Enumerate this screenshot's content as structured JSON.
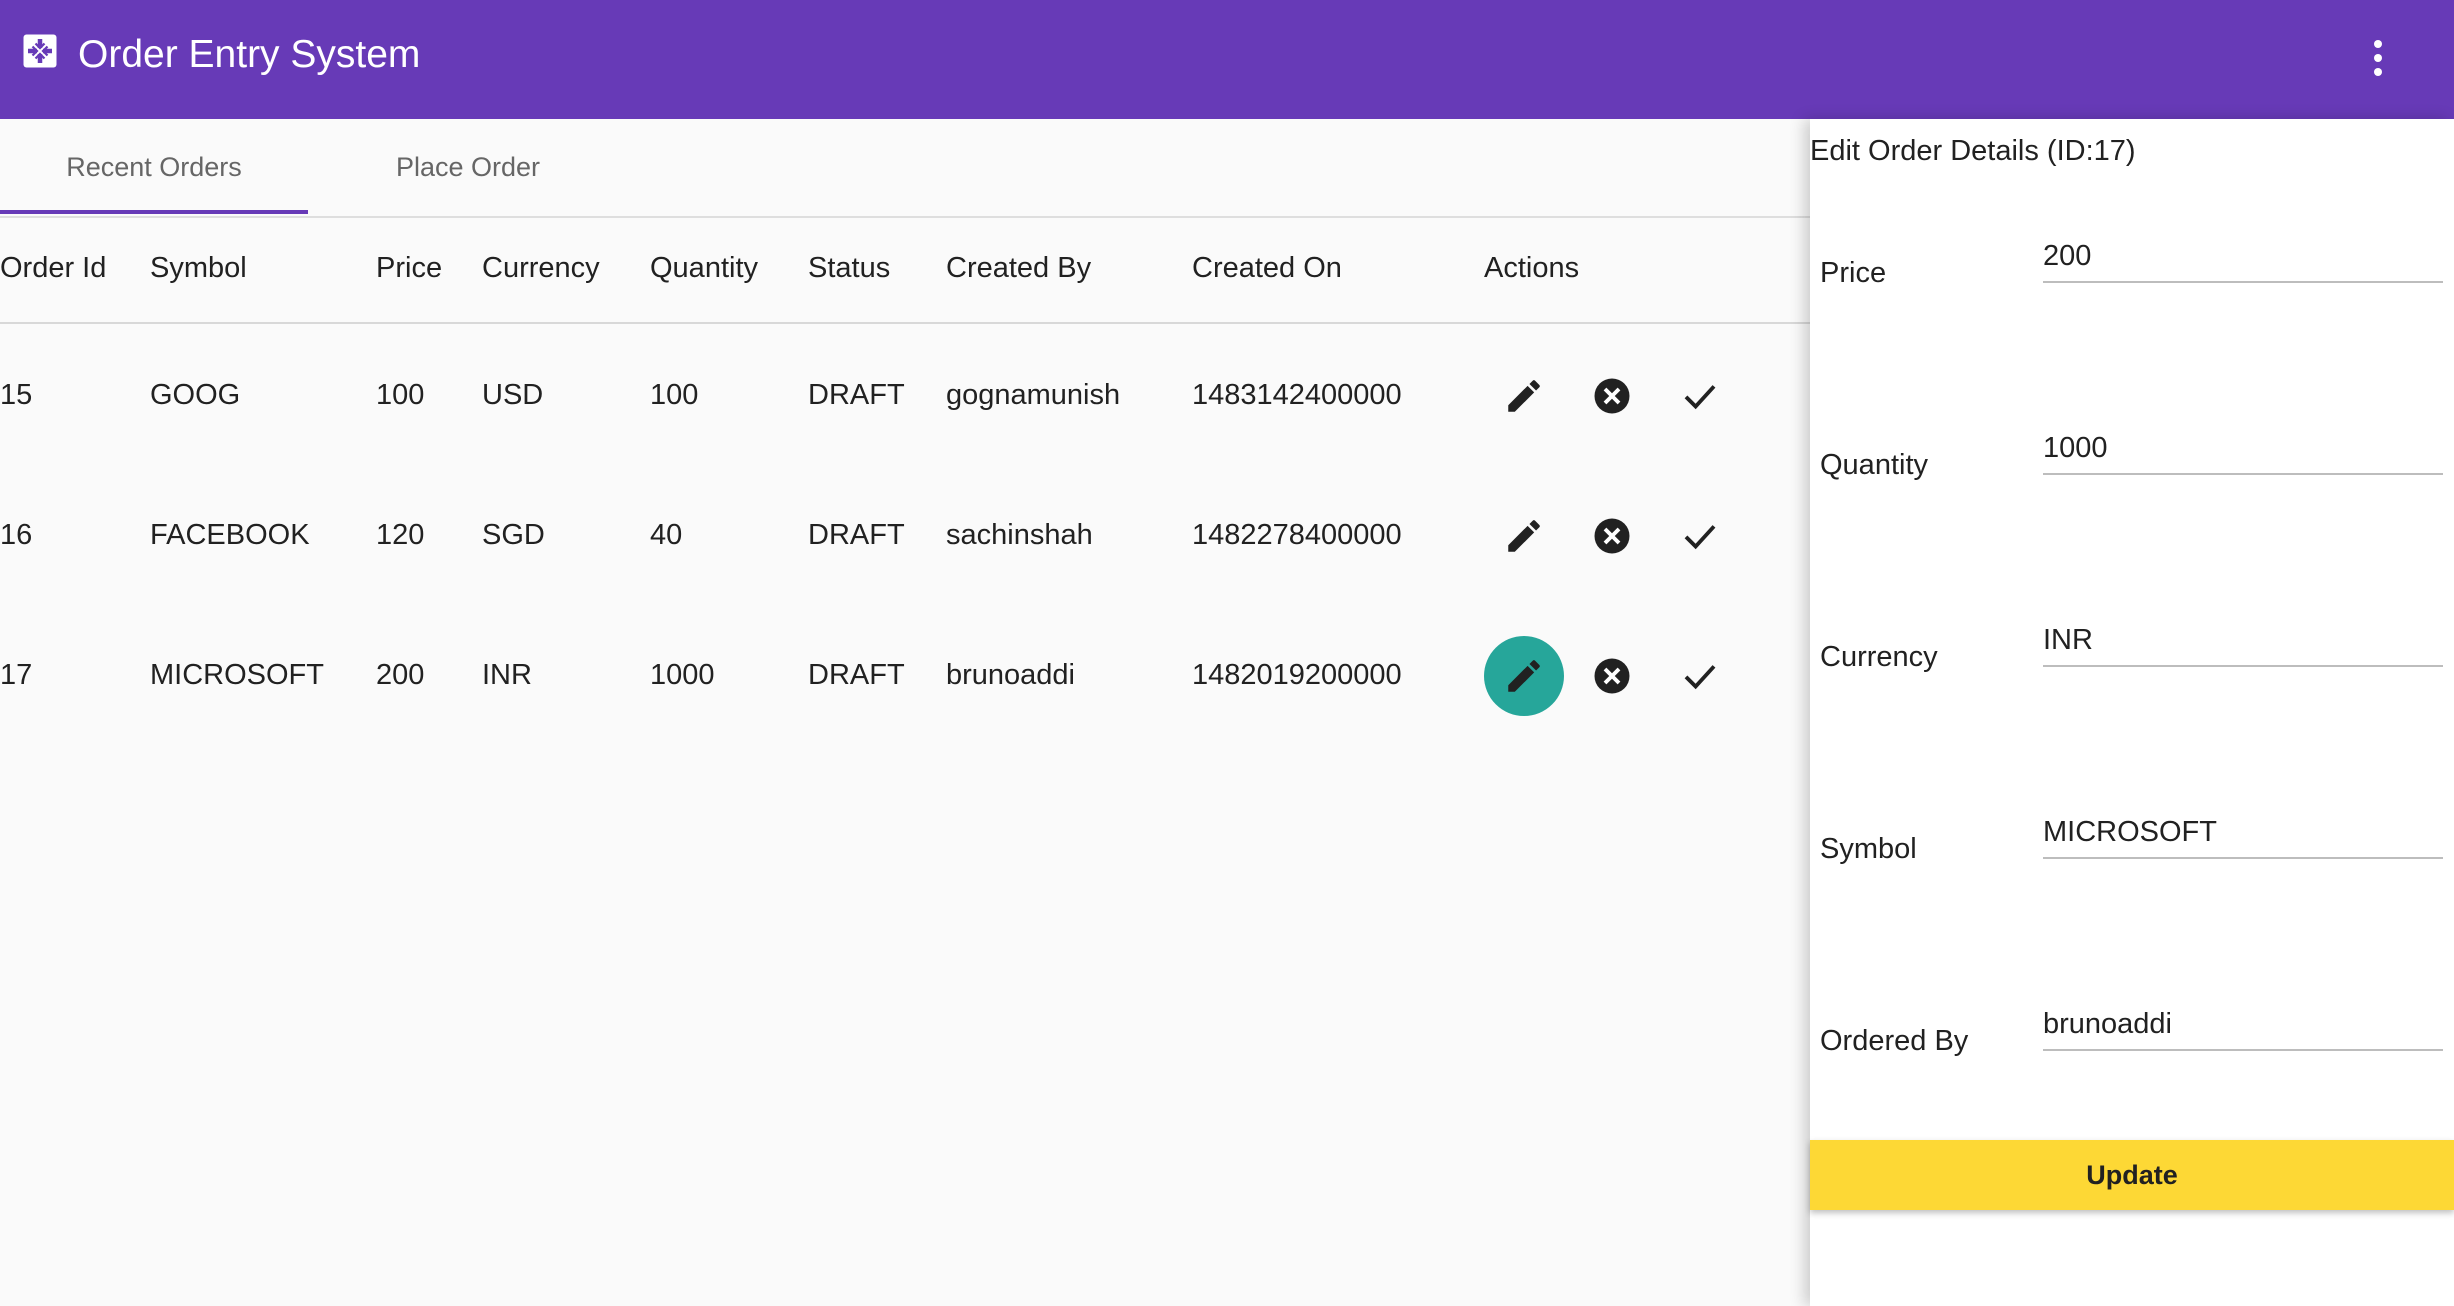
{
  "toolbar": {
    "title": "Order Entry System",
    "icon": "app-box-icon",
    "menu_icon": "more-vert-icon"
  },
  "tabs": [
    {
      "label": "Recent Orders",
      "active": true
    },
    {
      "label": "Place Order",
      "active": false
    }
  ],
  "table": {
    "headers": [
      "Order Id",
      "Symbol",
      "Price",
      "Currency",
      "Quantity",
      "Status",
      "Created By",
      "Created On",
      "Actions"
    ],
    "rows": [
      {
        "id": "15",
        "symbol": "GOOG",
        "price": "100",
        "currency": "USD",
        "quantity": "100",
        "status": "DRAFT",
        "created_by": "gognamunish",
        "created_on": "1483142400000"
      },
      {
        "id": "16",
        "symbol": "FACEBOOK",
        "price": "120",
        "currency": "SGD",
        "quantity": "40",
        "status": "DRAFT",
        "created_by": "sachinshah",
        "created_on": "1482278400000"
      },
      {
        "id": "17",
        "symbol": "MICROSOFT",
        "price": "200",
        "currency": "INR",
        "quantity": "1000",
        "status": "DRAFT",
        "created_by": "brunoaddi",
        "created_on": "1482019200000"
      }
    ],
    "action_icons": [
      "pencil-icon",
      "cancel-circle-icon",
      "check-icon"
    ],
    "highlight_color": "#26a69a"
  },
  "edit_panel": {
    "title": "Edit Order Details (ID:17)",
    "fields": [
      {
        "label": "Price",
        "value": "200"
      },
      {
        "label": "Quantity",
        "value": "1000"
      },
      {
        "label": "Currency",
        "value": "INR"
      },
      {
        "label": "Symbol",
        "value": "MICROSOFT"
      },
      {
        "label": "Ordered By",
        "value": "brunoaddi"
      }
    ],
    "update_label": "Update"
  },
  "colors": {
    "primary": "#673ab7",
    "accent": "#fdd835",
    "teal": "#26a69a"
  }
}
